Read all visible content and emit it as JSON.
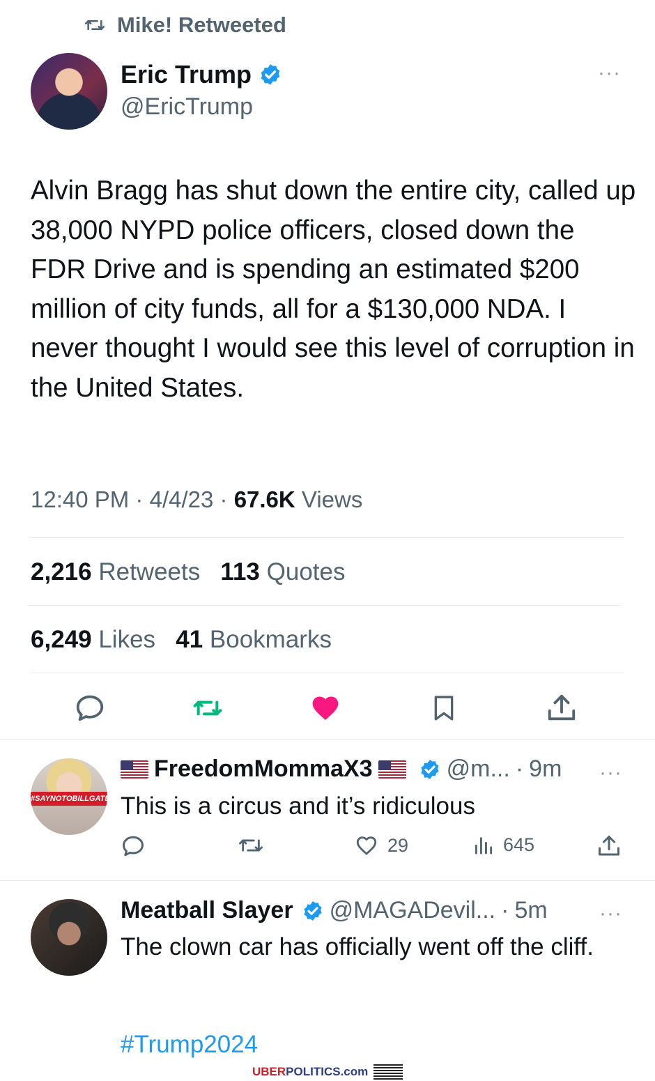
{
  "retweet_header": {
    "text": "Mike! Retweeted",
    "icon": "retweet-icon"
  },
  "main_tweet": {
    "author_name": "Eric Trump",
    "handle": "@EricTrump",
    "verified": true,
    "more_label": "···",
    "text": "Alvin Bragg has shut down the entire city, called up 38,000 NYPD police officers, closed down the FDR Drive and is spending an estimated $200 million of city funds, all for a $130,000 NDA. I never thought I would see this level of corruption in the United States.",
    "time": "12:40 PM",
    "date": "4/4/23",
    "views_count": "67.6K",
    "views_label": "Views",
    "retweets_count": "2,216",
    "retweets_label": "Retweets",
    "quotes_count": "113",
    "quotes_label": "Quotes",
    "likes_count": "6,249",
    "likes_label": "Likes",
    "bookmarks_count": "41",
    "bookmarks_label": "Bookmarks",
    "liked": true,
    "colors": {
      "like": "#f91880",
      "retweet": "#00ba7c",
      "link": "#1d9bf0",
      "verified": "#1d9bf0"
    }
  },
  "replies": [
    {
      "author_name": "FreedomMommaX3",
      "handle": "@m...",
      "time": "9m",
      "verified": true,
      "avatar_banner": "#SAYNOTOBILLGATES",
      "text": "This is a circus and it’s ridiculous",
      "likes": "29",
      "views": "645"
    },
    {
      "author_name": "Meatball Slayer",
      "handle": "@MAGADevil...",
      "time": "5m",
      "verified": true,
      "text": "The clown car has officially went off the cliff.",
      "hashtag": "#Trump2024"
    }
  ],
  "watermark": {
    "part1": "UBER",
    "part2": "POLITICS",
    "part3": ".com"
  }
}
